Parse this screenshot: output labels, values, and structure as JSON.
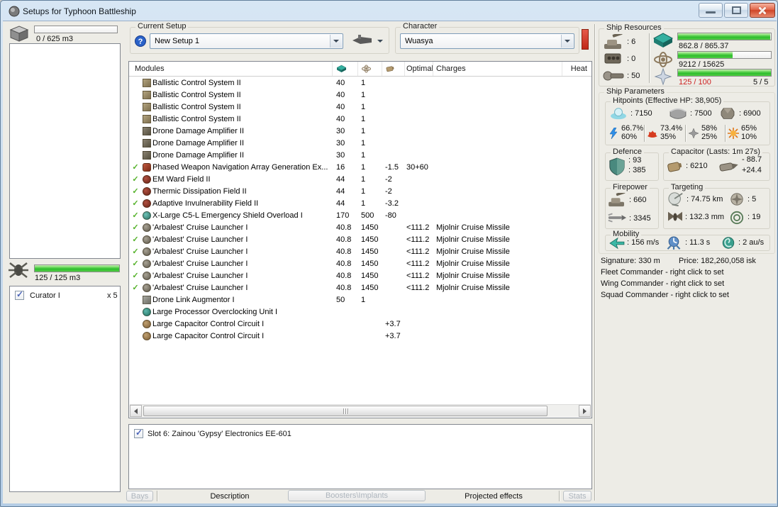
{
  "window": {
    "title": "Setups for Typhoon Battleship"
  },
  "cargo": {
    "label": "0 / 625 m3",
    "fill_pct": 0
  },
  "drone_bay": {
    "label": "125 / 125 m3",
    "fill_pct": 100,
    "items": [
      {
        "checked": true,
        "name": "Curator I",
        "qty": "x 5"
      }
    ]
  },
  "current_setup": {
    "label": "Current Setup",
    "value": "New Setup 1"
  },
  "character": {
    "label": "Character",
    "value": "Wuasya"
  },
  "modules_table": {
    "col_modules": "Modules",
    "col_optimal": "Optimal",
    "col_charges": "Charges",
    "col_heat": "Heat",
    "rows": [
      {
        "check": "",
        "icon": "bcs",
        "name": "Ballistic Control System II",
        "cpu": "40",
        "pg": "1",
        "cap": "",
        "optimal": "",
        "charges": ""
      },
      {
        "check": "",
        "icon": "bcs",
        "name": "Ballistic Control System II",
        "cpu": "40",
        "pg": "1",
        "cap": "",
        "optimal": "",
        "charges": ""
      },
      {
        "check": "",
        "icon": "bcs",
        "name": "Ballistic Control System II",
        "cpu": "40",
        "pg": "1",
        "cap": "",
        "optimal": "",
        "charges": ""
      },
      {
        "check": "",
        "icon": "bcs",
        "name": "Ballistic Control System II",
        "cpu": "40",
        "pg": "1",
        "cap": "",
        "optimal": "",
        "charges": ""
      },
      {
        "check": "",
        "icon": "dda",
        "name": "Drone Damage Amplifier II",
        "cpu": "30",
        "pg": "1",
        "cap": "",
        "optimal": "",
        "charges": ""
      },
      {
        "check": "",
        "icon": "dda",
        "name": "Drone Damage Amplifier II",
        "cpu": "30",
        "pg": "1",
        "cap": "",
        "optimal": "",
        "charges": ""
      },
      {
        "check": "",
        "icon": "dda",
        "name": "Drone Damage Amplifier II",
        "cpu": "30",
        "pg": "1",
        "cap": "",
        "optimal": "",
        "charges": ""
      },
      {
        "check": "✓",
        "icon": "painter",
        "name": "Phased Weapon Navigation Array Generation Ex...",
        "cpu": "16",
        "pg": "1",
        "cap": "-1.5",
        "optimal": "30+60",
        "charges": ""
      },
      {
        "check": "✓",
        "icon": "hardener",
        "name": "EM Ward Field II",
        "cpu": "44",
        "pg": "1",
        "cap": "-2",
        "optimal": "",
        "charges": ""
      },
      {
        "check": "✓",
        "icon": "hardener",
        "name": "Thermic Dissipation Field II",
        "cpu": "44",
        "pg": "1",
        "cap": "-2",
        "optimal": "",
        "charges": ""
      },
      {
        "check": "✓",
        "icon": "hardener",
        "name": "Adaptive Invulnerability Field II",
        "cpu": "44",
        "pg": "1",
        "cap": "-3.2",
        "optimal": "",
        "charges": ""
      },
      {
        "check": "✓",
        "icon": "booster",
        "name": "X-Large C5-L Emergency Shield Overload I",
        "cpu": "170",
        "pg": "500",
        "cap": "-80",
        "optimal": "",
        "charges": ""
      },
      {
        "check": "✓",
        "icon": "launcher",
        "name": "'Arbalest' Cruise Launcher I",
        "cpu": "40.8",
        "pg": "1450",
        "cap": "",
        "optimal": "<111.2",
        "charges": "Mjolnir Cruise Missile"
      },
      {
        "check": "✓",
        "icon": "launcher",
        "name": "'Arbalest' Cruise Launcher I",
        "cpu": "40.8",
        "pg": "1450",
        "cap": "",
        "optimal": "<111.2",
        "charges": "Mjolnir Cruise Missile"
      },
      {
        "check": "✓",
        "icon": "launcher",
        "name": "'Arbalest' Cruise Launcher I",
        "cpu": "40.8",
        "pg": "1450",
        "cap": "",
        "optimal": "<111.2",
        "charges": "Mjolnir Cruise Missile"
      },
      {
        "check": "✓",
        "icon": "launcher",
        "name": "'Arbalest' Cruise Launcher I",
        "cpu": "40.8",
        "pg": "1450",
        "cap": "",
        "optimal": "<111.2",
        "charges": "Mjolnir Cruise Missile"
      },
      {
        "check": "✓",
        "icon": "launcher",
        "name": "'Arbalest' Cruise Launcher I",
        "cpu": "40.8",
        "pg": "1450",
        "cap": "",
        "optimal": "<111.2",
        "charges": "Mjolnir Cruise Missile"
      },
      {
        "check": "✓",
        "icon": "launcher",
        "name": "'Arbalest' Cruise Launcher I",
        "cpu": "40.8",
        "pg": "1450",
        "cap": "",
        "optimal": "<111.2",
        "charges": "Mjolnir Cruise Missile"
      },
      {
        "check": "",
        "icon": "dla",
        "name": "Drone Link Augmentor I",
        "cpu": "50",
        "pg": "1",
        "cap": "",
        "optimal": "",
        "charges": ""
      },
      {
        "check": "",
        "icon": "rigcpu",
        "name": "Large Processor Overclocking Unit I",
        "cpu": "",
        "pg": "",
        "cap": "",
        "optimal": "",
        "charges": ""
      },
      {
        "check": "",
        "icon": "rigcap",
        "name": "Large Capacitor Control Circuit I",
        "cpu": "",
        "pg": "",
        "cap": "+3.7",
        "optimal": "",
        "charges": ""
      },
      {
        "check": "",
        "icon": "rigcap",
        "name": "Large Capacitor Control Circuit I",
        "cpu": "",
        "pg": "",
        "cap": "+3.7",
        "optimal": "",
        "charges": ""
      }
    ]
  },
  "implants": {
    "rows": [
      {
        "checked": true,
        "label": "Slot 6: Zainou 'Gypsy' Electronics EE-601"
      }
    ]
  },
  "bottom_bar": {
    "bays": "Bays",
    "description": "Description",
    "boosters_implants": "Boosters\\Implants",
    "projected_effects": "Projected effects",
    "stats": "Stats"
  },
  "ship_resources": {
    "title": "Ship Resources",
    "turret_hardpoints": ": 6",
    "launcher_hardpoints": ": 0",
    "rig_calibration": ": 50",
    "cpu": {
      "text": "862.8 / 865.37",
      "fill_pct": 99
    },
    "powergrid": {
      "text": "9212 / 15625",
      "fill_pct": 59
    },
    "calibration": {
      "text": "125 / 100",
      "fill_pct": 100,
      "rigs": "5 / 5"
    }
  },
  "ship_parameters": {
    "title": "Ship Parameters",
    "hitpoints": {
      "title": "Hitpoints (Effective HP: 38,905)",
      "shield_hp": ": 7150",
      "armor_hp": ": 7500",
      "hull_hp": ": 6900",
      "resists": [
        {
          "type": "em",
          "top": "66.7%",
          "bottom": "60%"
        },
        {
          "type": "thermal",
          "top": "73.4%",
          "bottom": "35%"
        },
        {
          "type": "kinetic",
          "top": "58%",
          "bottom": "25%"
        },
        {
          "type": "explosive",
          "top": "65%",
          "bottom": "10%"
        }
      ]
    },
    "defence": {
      "title": "Defence",
      "value1": ": 93",
      "value2": ": 385"
    },
    "capacitor": {
      "title": "Capacitor (Lasts: 1m 27s)",
      "amount": ": 6210",
      "drain": "- 88.7",
      "boost": "+24.4"
    },
    "firepower": {
      "title": "Firepower",
      "turret_dps": ": 660",
      "missile_dps": ": 3345"
    },
    "targeting": {
      "title": "Targeting",
      "range": ": 74.75 km",
      "max_targets": ": 5",
      "sig_resolution": ": 132.3 mm",
      "scan_resolution": ": 19"
    },
    "mobility": {
      "title": "Mobility",
      "speed": ": 156 m/s",
      "align_time": ": 11.3 s",
      "warp_speed": ": 2 au/s"
    },
    "signature": "Signature: 330 m",
    "price": "Price: 182,260,058 isk",
    "fleet": "Fleet Commander - right click to set",
    "wing": "Wing Commander - right click to set",
    "squad": "Squad Commander - right click to set"
  }
}
